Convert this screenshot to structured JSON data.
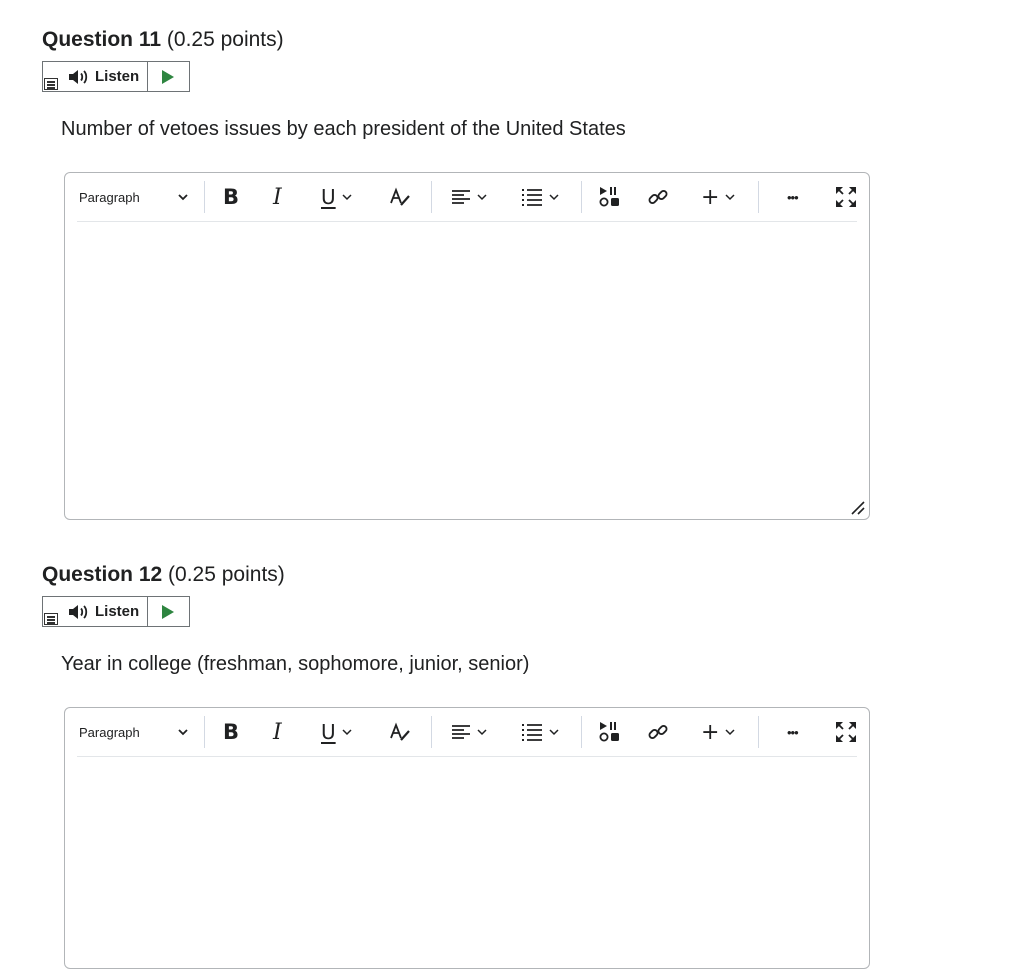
{
  "questions": [
    {
      "number_label": "Question 11",
      "points_label": "(0.25 points)",
      "listen_label": "Listen",
      "prompt": "Number of vetoes issues by each president of the United States",
      "editor": {
        "format_value": "Paragraph"
      }
    },
    {
      "number_label": "Question 12",
      "points_label": "(0.25 points)",
      "listen_label": "Listen",
      "prompt": "Year in college (freshman, sophomore, junior, senior)",
      "editor": {
        "format_value": "Paragraph"
      }
    }
  ],
  "toolbar_icons": {
    "bold": "B",
    "italic": "I",
    "underline": "U",
    "more": "•••",
    "insert": "+"
  },
  "colors": {
    "play_green": "#2e8540",
    "text": "#202122",
    "border": "#b2b5b8"
  }
}
